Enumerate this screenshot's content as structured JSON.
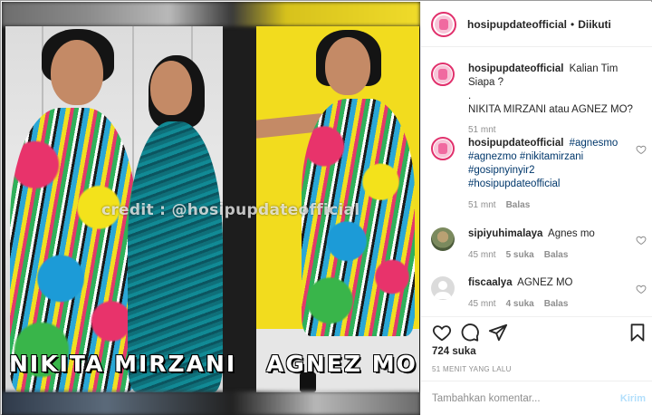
{
  "media": {
    "credit_watermark": "credit : @hosipupdateofficial",
    "left_caption": "NIKITA MIRZANI",
    "right_caption": "AGNEZ MO"
  },
  "header": {
    "username": "hosipupdateofficial",
    "separator": "•",
    "follow_status": "Diikuti",
    "avatar_icon": "profile-avatar"
  },
  "caption": {
    "username": "hosipupdateofficial",
    "line1": "Kalian Tim Siapa ?",
    "line2": ".",
    "line3": "NIKITA MIRZANI atau AGNEZ MO?",
    "time": "51 mnt"
  },
  "comments": [
    {
      "username": "hosipupdateofficial",
      "tags": [
        "#agnesmo",
        "#agnezmo",
        "#nikitamirzani",
        "#gosipnyinyir2",
        "#hosipupdateofficial"
      ],
      "time": "51 mnt",
      "reply": "Balas"
    },
    {
      "username": "sipiyuhimalaya",
      "text": "Agnes mo",
      "time": "45 mnt",
      "likes": "5 suka",
      "reply": "Balas"
    },
    {
      "username": "fiscaalya",
      "text": "AGNEZ MO",
      "time": "45 mnt",
      "likes": "4 suka",
      "reply": "Balas"
    }
  ],
  "actions": {
    "like_icon": "heart-icon",
    "comment_icon": "comment-icon",
    "share_icon": "paper-plane-icon",
    "save_icon": "bookmark-icon",
    "likes_count": "724 suka",
    "time_ago": "51 MENIT YANG LALU"
  },
  "composer": {
    "placeholder": "Tambahkan komentar...",
    "send_label": "Kirim"
  },
  "colors": {
    "link": "#00376b",
    "muted": "#8e8e8e",
    "send_disabled": "#b2dffc",
    "story_ring": "#e1306c"
  }
}
